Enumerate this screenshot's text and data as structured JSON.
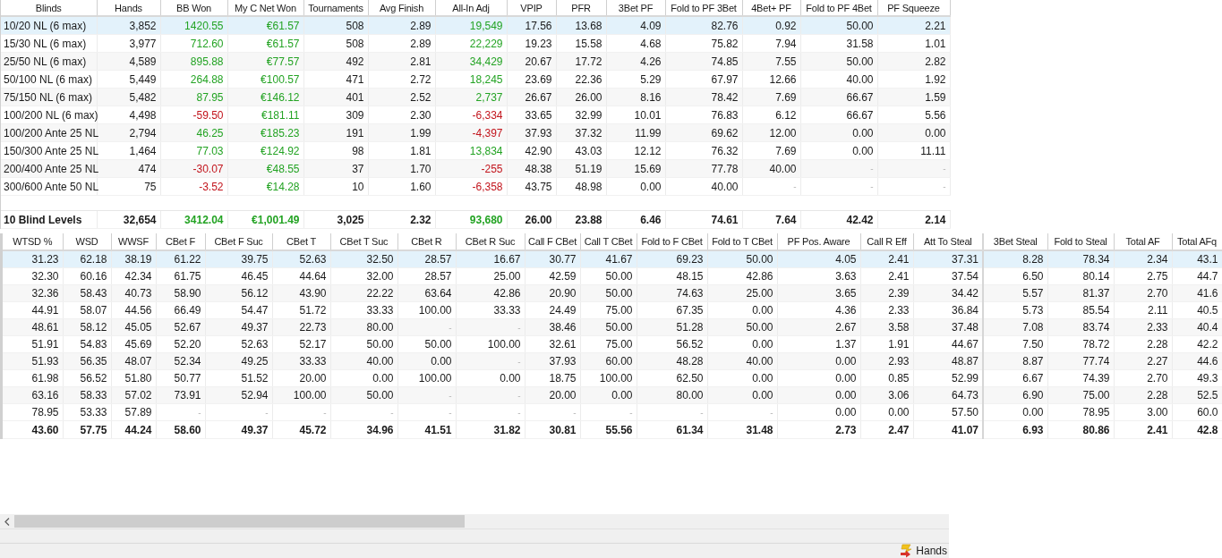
{
  "stats_table": {
    "columns": [
      "Blinds",
      "Hands",
      "BB Won",
      "My C Net Won",
      "Tournaments",
      "Avg Finish",
      "All-In Adj",
      "VPIP",
      "PFR",
      "3Bet PF",
      "Fold to PF 3Bet",
      "4Bet+ PF",
      "Fold to PF 4Bet",
      "PF Squeeze"
    ],
    "rows": [
      {
        "selected": true,
        "cells": [
          "10/20 NL (6 max)",
          "3,852",
          {
            "text": "1420.55",
            "kind": "gain"
          },
          {
            "text": "€61.57",
            "kind": "gain"
          },
          "508",
          "2.89",
          {
            "text": "19,549",
            "kind": "gain"
          },
          "17.56",
          "13.68",
          "4.09",
          "82.76",
          "0.92",
          "50.00",
          "2.21"
        ]
      },
      {
        "selected": false,
        "cells": [
          "15/30 NL (6 max)",
          "3,977",
          {
            "text": "712.60",
            "kind": "gain"
          },
          {
            "text": "€61.57",
            "kind": "gain"
          },
          "508",
          "2.89",
          {
            "text": "22,229",
            "kind": "gain"
          },
          "19.23",
          "15.58",
          "4.68",
          "75.82",
          "7.94",
          "31.58",
          "1.01"
        ]
      },
      {
        "selected": false,
        "cells": [
          "25/50 NL (6 max)",
          "4,589",
          {
            "text": "895.88",
            "kind": "gain"
          },
          {
            "text": "€77.57",
            "kind": "gain"
          },
          "492",
          "2.81",
          {
            "text": "34,429",
            "kind": "gain"
          },
          "20.67",
          "17.72",
          "4.26",
          "74.85",
          "7.55",
          "50.00",
          "2.82"
        ]
      },
      {
        "selected": false,
        "cells": [
          "50/100 NL (6 max)",
          "5,449",
          {
            "text": "264.88",
            "kind": "gain"
          },
          {
            "text": "€100.57",
            "kind": "gain"
          },
          "471",
          "2.72",
          {
            "text": "18,245",
            "kind": "gain"
          },
          "23.69",
          "22.36",
          "5.29",
          "67.97",
          "12.66",
          "40.00",
          "1.92"
        ]
      },
      {
        "selected": false,
        "cells": [
          "75/150 NL (6 max)",
          "5,482",
          {
            "text": "87.95",
            "kind": "gain"
          },
          {
            "text": "€146.12",
            "kind": "gain"
          },
          "401",
          "2.52",
          {
            "text": "2,737",
            "kind": "gain"
          },
          "26.67",
          "26.00",
          "8.16",
          "78.42",
          "7.69",
          "66.67",
          "1.59"
        ]
      },
      {
        "selected": false,
        "cells": [
          "100/200 NL (6 max)",
          "4,498",
          {
            "text": "-59.50",
            "kind": "loss"
          },
          {
            "text": "€181.11",
            "kind": "gain"
          },
          "309",
          "2.30",
          {
            "text": "-6,334",
            "kind": "loss"
          },
          "33.65",
          "32.99",
          "10.01",
          "76.83",
          "6.12",
          "66.67",
          "5.56"
        ]
      },
      {
        "selected": false,
        "cells": [
          "100/200 Ante 25 NL",
          "2,794",
          {
            "text": "46.25",
            "kind": "gain"
          },
          {
            "text": "€185.23",
            "kind": "gain"
          },
          "191",
          "1.99",
          {
            "text": "-4,397",
            "kind": "loss"
          },
          "37.93",
          "37.32",
          "11.99",
          "69.62",
          "12.00",
          "0.00",
          "0.00"
        ]
      },
      {
        "selected": false,
        "cells": [
          "150/300 Ante 25 NL",
          "1,464",
          {
            "text": "77.03",
            "kind": "gain"
          },
          {
            "text": "€124.92",
            "kind": "gain"
          },
          "98",
          "1.81",
          {
            "text": "13,834",
            "kind": "gain"
          },
          "42.90",
          "43.03",
          "12.12",
          "76.32",
          "7.69",
          "0.00",
          "11.11"
        ]
      },
      {
        "selected": false,
        "cells": [
          "200/400 Ante 25 NL",
          "474",
          {
            "text": "-30.07",
            "kind": "loss"
          },
          {
            "text": "€48.55",
            "kind": "gain"
          },
          "37",
          "1.70",
          {
            "text": "-255",
            "kind": "loss"
          },
          "48.38",
          "51.19",
          "15.69",
          "77.78",
          "40.00",
          {
            "text": "-",
            "kind": "blank"
          },
          {
            "text": "-",
            "kind": "blank"
          }
        ]
      },
      {
        "selected": false,
        "cells": [
          "300/600 Ante 50 NL",
          "75",
          {
            "text": "-3.52",
            "kind": "loss"
          },
          {
            "text": "€14.28",
            "kind": "gain"
          },
          "10",
          "1.60",
          {
            "text": "-6,358",
            "kind": "loss"
          },
          "43.75",
          "48.98",
          "0.00",
          "40.00",
          {
            "text": "-",
            "kind": "blank"
          },
          {
            "text": "-",
            "kind": "blank"
          },
          {
            "text": "-",
            "kind": "blank"
          }
        ]
      }
    ],
    "total": [
      "10 Blind Levels",
      "32,654",
      {
        "text": "3412.04",
        "kind": "gain"
      },
      {
        "text": "€1,001.49",
        "kind": "gain"
      },
      "3,025",
      "2.32",
      {
        "text": "93,680",
        "kind": "gain"
      },
      "26.00",
      "23.88",
      "6.46",
      "74.61",
      "7.64",
      "42.42",
      "2.14"
    ]
  },
  "detail_table": {
    "columns": [
      "WTSD %",
      "WSD",
      "WWSF",
      "CBet F",
      "CBet F Suc",
      "CBet T",
      "CBet T Suc",
      "CBet R",
      "CBet R Suc",
      "Call F CBet",
      "Call T CBet",
      "Fold to F CBet",
      "Fold to T CBet",
      "PF Pos. Aware",
      "Call R Eff",
      "Att To Steal",
      "3Bet Steal",
      "Fold to Steal",
      "Total AF",
      "Total AFq"
    ],
    "rows": [
      {
        "selected": true,
        "cells": [
          "31.23",
          "62.18",
          "38.19",
          "61.22",
          "39.75",
          "52.63",
          "32.50",
          "28.57",
          "16.67",
          "30.77",
          "41.67",
          "69.23",
          "50.00",
          "4.05",
          "2.41",
          "37.31",
          "8.28",
          "78.34",
          "2.34",
          "43.1"
        ]
      },
      {
        "selected": false,
        "cells": [
          "32.30",
          "60.16",
          "42.34",
          "61.75",
          "46.45",
          "44.64",
          "32.00",
          "28.57",
          "25.00",
          "42.59",
          "50.00",
          "48.15",
          "42.86",
          "3.63",
          "2.41",
          "37.54",
          "6.50",
          "80.14",
          "2.75",
          "44.7"
        ]
      },
      {
        "selected": false,
        "cells": [
          "32.36",
          "58.43",
          "40.73",
          "58.90",
          "56.12",
          "43.90",
          "22.22",
          "63.64",
          "42.86",
          "20.90",
          "50.00",
          "74.63",
          "25.00",
          "3.65",
          "2.39",
          "34.42",
          "5.57",
          "81.37",
          "2.70",
          "41.6"
        ]
      },
      {
        "selected": false,
        "cells": [
          "44.91",
          "58.07",
          "44.56",
          "66.49",
          "54.47",
          "51.72",
          "33.33",
          "100.00",
          "33.33",
          "24.49",
          "75.00",
          "67.35",
          "0.00",
          "4.36",
          "2.33",
          "36.84",
          "5.73",
          "85.54",
          "2.11",
          "40.5"
        ]
      },
      {
        "selected": false,
        "cells": [
          "48.61",
          "58.12",
          "45.05",
          "52.67",
          "49.37",
          "22.73",
          "80.00",
          {
            "text": "-",
            "kind": "blank"
          },
          {
            "text": "-",
            "kind": "blank"
          },
          "38.46",
          "50.00",
          "51.28",
          "50.00",
          "2.67",
          "3.58",
          "37.48",
          "7.08",
          "83.74",
          "2.33",
          "40.4"
        ]
      },
      {
        "selected": false,
        "cells": [
          "51.91",
          "54.83",
          "45.69",
          "52.20",
          "52.63",
          "52.17",
          "50.00",
          "50.00",
          "100.00",
          "32.61",
          "75.00",
          "56.52",
          "0.00",
          "1.37",
          "1.91",
          "44.67",
          "7.50",
          "78.72",
          "2.28",
          "42.2"
        ]
      },
      {
        "selected": false,
        "cells": [
          "51.93",
          "56.35",
          "48.07",
          "52.34",
          "49.25",
          "33.33",
          "40.00",
          "0.00",
          {
            "text": "-",
            "kind": "blank"
          },
          "37.93",
          "60.00",
          "48.28",
          "40.00",
          "0.00",
          "2.93",
          "48.87",
          "8.87",
          "77.74",
          "2.27",
          "44.6"
        ]
      },
      {
        "selected": false,
        "cells": [
          "61.98",
          "56.52",
          "51.80",
          "50.77",
          "51.52",
          "20.00",
          "0.00",
          "100.00",
          "0.00",
          "18.75",
          "100.00",
          "62.50",
          "0.00",
          "0.00",
          "0.85",
          "52.99",
          "6.67",
          "74.39",
          "2.70",
          "49.3"
        ]
      },
      {
        "selected": false,
        "cells": [
          "63.16",
          "58.33",
          "57.02",
          "73.91",
          "52.94",
          "100.00",
          "50.00",
          {
            "text": "-",
            "kind": "blank"
          },
          {
            "text": "-",
            "kind": "blank"
          },
          "20.00",
          "0.00",
          "80.00",
          "0.00",
          "0.00",
          "3.06",
          "64.73",
          "6.90",
          "75.00",
          "2.28",
          "52.5"
        ]
      },
      {
        "selected": false,
        "cells": [
          "78.95",
          "53.33",
          "57.89",
          {
            "text": "-",
            "kind": "blank"
          },
          {
            "text": "-",
            "kind": "blank"
          },
          {
            "text": "-",
            "kind": "blank"
          },
          {
            "text": "-",
            "kind": "blank"
          },
          {
            "text": "-",
            "kind": "blank"
          },
          {
            "text": "-",
            "kind": "blank"
          },
          {
            "text": "-",
            "kind": "blank"
          },
          {
            "text": "-",
            "kind": "blank"
          },
          {
            "text": "-",
            "kind": "blank"
          },
          {
            "text": "-",
            "kind": "blank"
          },
          "0.00",
          "0.00",
          "57.50",
          "0.00",
          "78.95",
          "3.00",
          "60.0"
        ]
      }
    ],
    "total": [
      "43.60",
      "57.75",
      "44.24",
      "58.60",
      "49.37",
      "45.72",
      "34.96",
      "41.51",
      "31.82",
      "30.81",
      "55.56",
      "61.34",
      "31.48",
      "2.73",
      "2.47",
      "41.07",
      "6.93",
      "80.86",
      "2.41",
      "42.8"
    ]
  },
  "status_bar": {
    "label": "Hands"
  }
}
